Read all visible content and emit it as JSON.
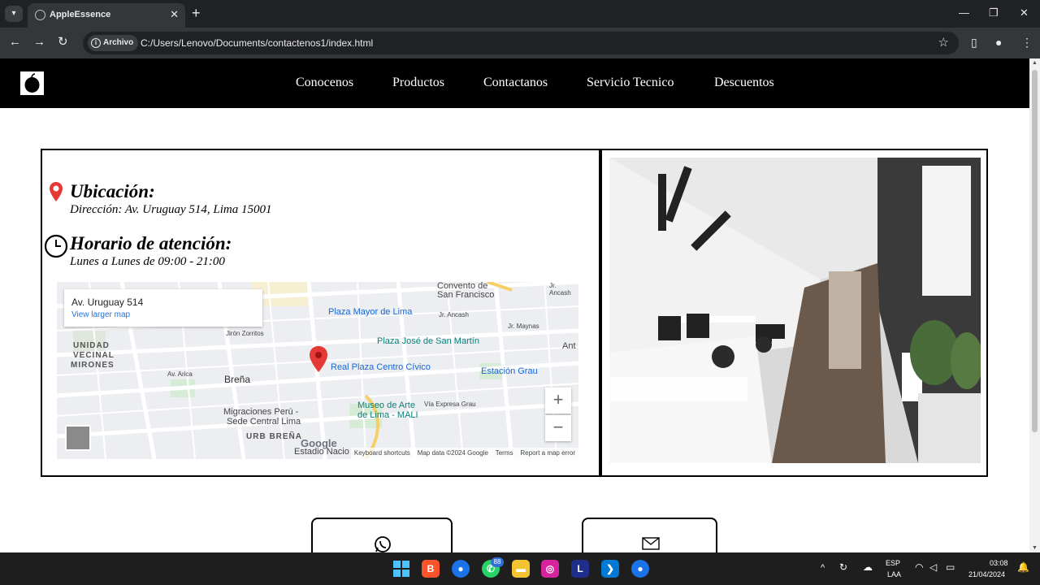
{
  "browser": {
    "tab_title": "AppleEssence",
    "omnibox_chip": "Archivo",
    "url": "C:/Users/Lenovo/Documents/contactenos1/index.html"
  },
  "nav": {
    "items": [
      "Conocenos",
      "Productos",
      "Contactanos",
      "Servicio Tecnico",
      "Descuentos"
    ]
  },
  "location": {
    "title": "Ubicación:",
    "address": "Dirección: Av. Uruguay 514, Lima 15001"
  },
  "hours": {
    "title": "Horario de atención:",
    "schedule": "Lunes a Lunes de 09:00 - 21:00"
  },
  "map": {
    "card_address": "Av. Uruguay 514",
    "card_link": "View larger map",
    "labels": {
      "convento": "Convento de",
      "san_francisco": "San Francisco",
      "plaza_mayor": "Plaza Mayor de Lima",
      "jiron_zorritos": "Jirón Zorritos",
      "ancash": "Jr. Ancash",
      "plaza_jose": "Plaza José de San Martín",
      "unidad": "UNIDAD",
      "vecinal": "VECINAL",
      "mirones": "MIRONES",
      "arica": "Av. Arica",
      "brena": "Breña",
      "real_plaza": "Real Plaza Centro Cívico",
      "estacion_grau": "Estación Grau",
      "museo1": "Museo de Arte",
      "museo2": "de Lima - MALI",
      "via_expresa": "Vía Expresa Grau",
      "migraciones1": "Migraciones Perú -",
      "migraciones2": "Sede Central Lima",
      "urb_brena": "URB BREÑA",
      "estadio": "Estadio Nacio",
      "ant": "Ant",
      "maynas": "Jr. Maynas",
      "ancash_top": "Jr. Ancash"
    },
    "zoom_in": "+",
    "zoom_out": "−",
    "google": "Google",
    "attribution": {
      "shortcuts": "Keyboard shortcuts",
      "data": "Map data ©2024 Google",
      "terms": "Terms",
      "report": "Report a map error"
    }
  },
  "taskbar": {
    "whatsapp_badge": "88",
    "lang_top": "ESP",
    "lang_bottom": "LAA",
    "time": "03:08",
    "date": "21/04/2024"
  },
  "colors": {
    "pin_red": "#e53935",
    "header_bg": "#000000",
    "map_blue": "#1967d2"
  }
}
